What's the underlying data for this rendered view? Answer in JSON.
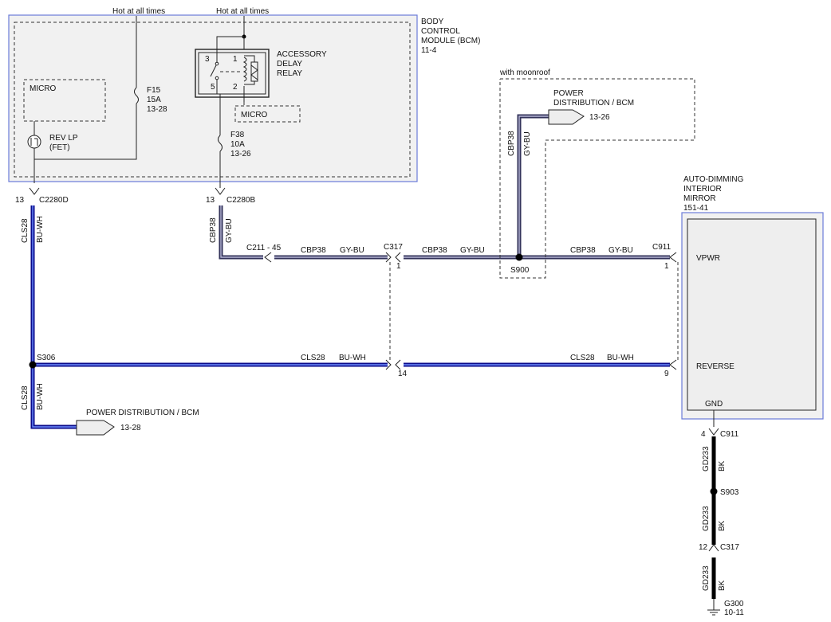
{
  "bcm": {
    "title": [
      "BODY",
      "CONTROL",
      "MODULE (BCM)",
      "11-4"
    ],
    "hot_left": "Hot at all times",
    "hot_right": "Hot at all times",
    "micro_left": "MICRO",
    "micro_right": "MICRO",
    "fuse_f15": [
      "F15",
      "15A",
      "13-28"
    ],
    "fuse_f38": [
      "F38",
      "10A",
      "13-26"
    ],
    "relay": [
      "ACCESSORY",
      "DELAY",
      "RELAY"
    ],
    "relay_pins": [
      "3",
      "1",
      "5",
      "2"
    ],
    "rev_lp": [
      "REV LP",
      "(FET)"
    ]
  },
  "connectors": {
    "c2280d_pin": "13",
    "c2280d": "C2280D",
    "c2280b_pin": "13",
    "c2280b": "C2280B",
    "c211": "C211 - 45",
    "c317_top": "C317",
    "c317_top_pin": "1",
    "c317_low_pin": "14",
    "c911_top": "C911",
    "c911_top_pin": "1",
    "c911_low_pin": "9",
    "c911_gnd_pin": "4",
    "c911_gnd": "C911",
    "c317_gnd_pin": "12",
    "c317_gnd": "C317"
  },
  "splices": {
    "s900": "S900",
    "s306": "S306",
    "s903": "S903"
  },
  "wires": {
    "cls28": "CLS28",
    "bu_wh": "BU-WH",
    "cbp38": "CBP38",
    "gy_bu": "GY-BU",
    "gd233": "GD233",
    "bk": "BK"
  },
  "moonroof": {
    "label": "with moonroof",
    "power_dist": [
      "POWER",
      "DISTRIBUTION / BCM"
    ],
    "ref": "13-26"
  },
  "power_dist_bottom": {
    "label": "POWER DISTRIBUTION / BCM",
    "ref": "13-28"
  },
  "mirror": {
    "title": [
      "AUTO-DIMMING",
      "INTERIOR",
      "MIRROR",
      "151-41"
    ],
    "vpwr": "VPWR",
    "reverse": "REVERSE",
    "gnd": "GND"
  },
  "ground": {
    "label": "G300",
    "ref": "10-11"
  },
  "colors": {
    "wire_blue": "#0a0a8a",
    "wire_gray": "#33335a",
    "module_outline": "#6b7bd9",
    "module_fill": "#f1f1f1"
  }
}
